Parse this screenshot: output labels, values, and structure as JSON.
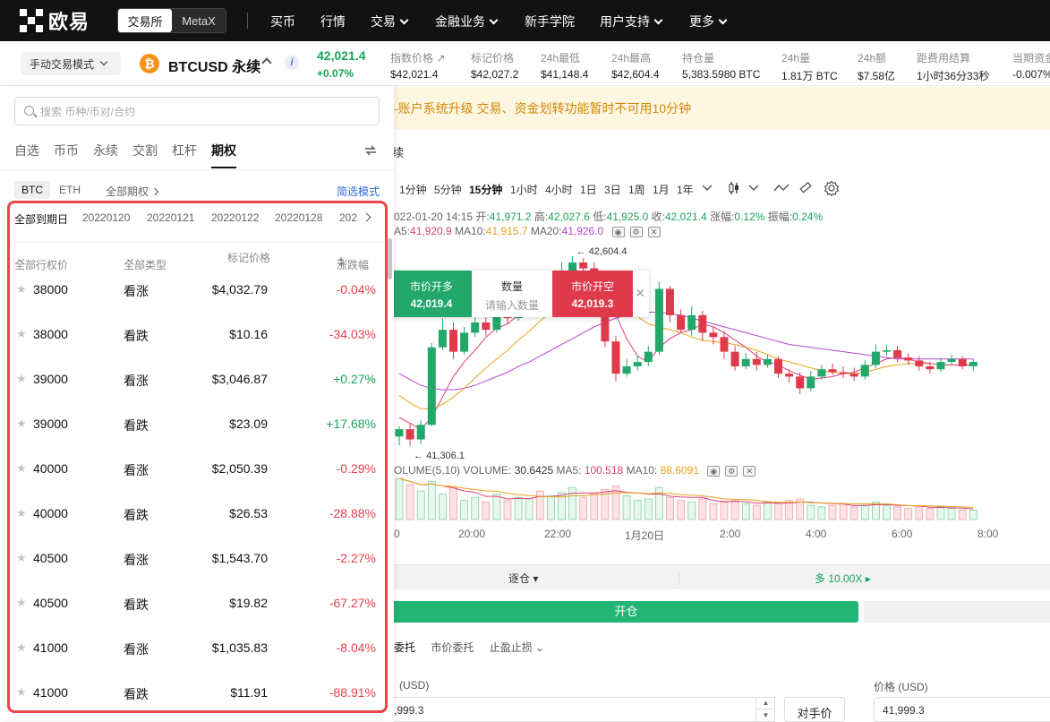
{
  "nav": {
    "logo_text": "欧易",
    "switch": [
      "交易所",
      "MetaX"
    ],
    "items": [
      {
        "label": "买币",
        "dropdown": false
      },
      {
        "label": "行情",
        "dropdown": false
      },
      {
        "label": "交易",
        "dropdown": true
      },
      {
        "label": "金融业务",
        "dropdown": true
      },
      {
        "label": "新手学院",
        "dropdown": false
      },
      {
        "label": "用户支持",
        "dropdown": true
      },
      {
        "label": "更多",
        "dropdown": true
      }
    ]
  },
  "ticker": {
    "mode": "手动交易模式",
    "symbol": "BTCUSD 永续",
    "coin_glyph": "₿",
    "info_glyph": "i",
    "last_price": "42,021.4",
    "change": "+0.07%",
    "stats": [
      {
        "label": "指数价格 ↗",
        "value": "$42,021.4"
      },
      {
        "label": "标记价格",
        "value": "$42,027.2"
      },
      {
        "label": "24h最低",
        "value": "$41,148.4"
      },
      {
        "label": "24h最高",
        "value": "$42,604.4"
      },
      {
        "label": "持仓量",
        "value": "5,383.5980 BTC"
      },
      {
        "label": "24h量",
        "value": "1.81万 BTC"
      },
      {
        "label": "24h额",
        "value": "$7.58亿"
      },
      {
        "label": "距费用结算",
        "value": "1小时36分33秒"
      },
      {
        "label": "当期资金",
        "value": "-0.007%"
      }
    ]
  },
  "notice": "-账户系统升级 交易、资金划转功能暂时不可用10分钟",
  "chart": {
    "title_fragment": "续",
    "timeframes": [
      "1分钟",
      "5分钟",
      "15分钟",
      "1小时",
      "4小时",
      "1日",
      "3日",
      "1周",
      "1月",
      "1年"
    ],
    "selected_timeframe": "15分钟",
    "ohlc": {
      "time": "022-01-20 14:15",
      "open_label": "开:",
      "open": "41,971.2",
      "high_label": "高:",
      "high": "42,027.6",
      "low_label": "低:",
      "low": "41,925.0",
      "close_label": "收:",
      "close": "42,021.4",
      "amp_label": "涨幅:",
      "amp": "0.12%",
      "swing_label": "振幅:",
      "swing": "0.24%"
    },
    "ma": [
      {
        "label": "A5:",
        "value": "41,920.9",
        "color": "#d9407a"
      },
      {
        "label": "MA10:",
        "value": "41,915.7",
        "color": "#e8a317"
      },
      {
        "label": "MA20:",
        "value": "41,926.0",
        "color": "#b546d6"
      }
    ],
    "high_marker": "42,604.4",
    "low_marker": "41,306.1",
    "volume_legend": {
      "name": "OLUME(5,10)",
      "vol_label": "VOLUME:",
      "vol": "30.6425",
      "ma5_label": "MA5:",
      "ma5": "100.518",
      "ma10_label": "MA10:",
      "ma10": "88.6091"
    },
    "xaxis": [
      "0",
      "20:00",
      "22:00",
      "1月20日",
      "2:00",
      "4:00",
      "6:00",
      "8:00"
    ],
    "quick_trade": {
      "buy_label": "市价开多",
      "buy_price": "42,019.4",
      "qty_label": "数量",
      "qty_placeholder": "请输入数量",
      "sell_label": "市价开空",
      "sell_price": "42,019.3",
      "close": "✕"
    }
  },
  "chart_data": {
    "type": "candlestick",
    "up_color": "#22a86a",
    "down_color": "#df3a4c",
    "candles": [
      {
        "o": 41370,
        "c": 41420,
        "h": 41440,
        "l": 41310
      },
      {
        "o": 41420,
        "c": 41350,
        "h": 41460,
        "l": 41306
      },
      {
        "o": 41350,
        "c": 41450,
        "h": 41480,
        "l": 41320
      },
      {
        "o": 41450,
        "c": 41980,
        "h": 42010,
        "l": 41440
      },
      {
        "o": 41980,
        "c": 42100,
        "h": 42180,
        "l": 41960
      },
      {
        "o": 42100,
        "c": 41950,
        "h": 42150,
        "l": 41900
      },
      {
        "o": 41950,
        "c": 42080,
        "h": 42120,
        "l": 41930
      },
      {
        "o": 42080,
        "c": 42150,
        "h": 42200,
        "l": 42050
      },
      {
        "o": 42150,
        "c": 42100,
        "h": 42210,
        "l": 42060
      },
      {
        "o": 42100,
        "c": 42230,
        "h": 42280,
        "l": 42080
      },
      {
        "o": 42230,
        "c": 42180,
        "h": 42300,
        "l": 42140
      },
      {
        "o": 42180,
        "c": 42300,
        "h": 42350,
        "l": 42160
      },
      {
        "o": 42300,
        "c": 42380,
        "h": 42430,
        "l": 42270
      },
      {
        "o": 42380,
        "c": 42320,
        "h": 42440,
        "l": 42290
      },
      {
        "o": 42320,
        "c": 42410,
        "h": 42460,
        "l": 42300
      },
      {
        "o": 42410,
        "c": 42500,
        "h": 42560,
        "l": 42390
      },
      {
        "o": 42500,
        "c": 42560,
        "h": 42604,
        "l": 42480
      },
      {
        "o": 42560,
        "c": 42520,
        "h": 42590,
        "l": 42470
      },
      {
        "o": 42520,
        "c": 42400,
        "h": 42560,
        "l": 42360
      },
      {
        "o": 42400,
        "c": 42020,
        "h": 42430,
        "l": 41980
      },
      {
        "o": 42020,
        "c": 41800,
        "h": 42060,
        "l": 41750
      },
      {
        "o": 41800,
        "c": 41850,
        "h": 41900,
        "l": 41780
      },
      {
        "o": 41850,
        "c": 41880,
        "h": 41920,
        "l": 41820
      },
      {
        "o": 41880,
        "c": 41950,
        "h": 41990,
        "l": 41850
      },
      {
        "o": 41950,
        "c": 42380,
        "h": 42430,
        "l": 41930
      },
      {
        "o": 42380,
        "c": 42200,
        "h": 42400,
        "l": 42150
      },
      {
        "o": 42200,
        "c": 42100,
        "h": 42240,
        "l": 42080
      },
      {
        "o": 42100,
        "c": 42200,
        "h": 42260,
        "l": 42060
      },
      {
        "o": 42200,
        "c": 42080,
        "h": 42230,
        "l": 42020
      },
      {
        "o": 42080,
        "c": 42050,
        "h": 42120,
        "l": 42000
      },
      {
        "o": 42050,
        "c": 41950,
        "h": 42090,
        "l": 41900
      },
      {
        "o": 41950,
        "c": 41850,
        "h": 41990,
        "l": 41820
      },
      {
        "o": 41850,
        "c": 41900,
        "h": 41940,
        "l": 41830
      },
      {
        "o": 41900,
        "c": 41860,
        "h": 41950,
        "l": 41820
      },
      {
        "o": 41860,
        "c": 41900,
        "h": 41930,
        "l": 41840
      },
      {
        "o": 41900,
        "c": 41800,
        "h": 41920,
        "l": 41770
      },
      {
        "o": 41800,
        "c": 41780,
        "h": 41830,
        "l": 41740
      },
      {
        "o": 41780,
        "c": 41700,
        "h": 41810,
        "l": 41660
      },
      {
        "o": 41700,
        "c": 41780,
        "h": 41820,
        "l": 41680
      },
      {
        "o": 41780,
        "c": 41830,
        "h": 41860,
        "l": 41760
      },
      {
        "o": 41830,
        "c": 41810,
        "h": 41870,
        "l": 41790
      },
      {
        "o": 41810,
        "c": 41800,
        "h": 41850,
        "l": 41770
      },
      {
        "o": 41800,
        "c": 41780,
        "h": 41840,
        "l": 41750
      },
      {
        "o": 41780,
        "c": 41860,
        "h": 41890,
        "l": 41760
      },
      {
        "o": 41860,
        "c": 41950,
        "h": 42000,
        "l": 41840
      },
      {
        "o": 41950,
        "c": 41960,
        "h": 42000,
        "l": 41920
      },
      {
        "o": 41960,
        "c": 41910,
        "h": 41990,
        "l": 41880
      },
      {
        "o": 41910,
        "c": 41890,
        "h": 41940,
        "l": 41860
      },
      {
        "o": 41890,
        "c": 41850,
        "h": 41920,
        "l": 41820
      },
      {
        "o": 41850,
        "c": 41830,
        "h": 41880,
        "l": 41800
      },
      {
        "o": 41830,
        "c": 41880,
        "h": 41910,
        "l": 41810
      },
      {
        "o": 41880,
        "c": 41900,
        "h": 41930,
        "l": 41860
      },
      {
        "o": 41900,
        "c": 41850,
        "h": 41920,
        "l": 41830
      },
      {
        "o": 41850,
        "c": 41880,
        "h": 41900,
        "l": 41820
      }
    ],
    "ma5": [
      41500,
      41460,
      41420,
      41500,
      41640,
      41780,
      41880,
      41960,
      42050,
      42110,
      42140,
      42200,
      42240,
      42290,
      42360,
      42410,
      42440,
      42460,
      42430,
      42340,
      42200,
      42040,
      41920,
      41880,
      41980,
      42040,
      42080,
      42100,
      42140,
      42120,
      42080,
      42030,
      41980,
      41920,
      41880,
      41860,
      41820,
      41790,
      41760,
      41770,
      41780,
      41800,
      41810,
      41840,
      41870,
      41900,
      41910,
      41900,
      41880,
      41870,
      41860,
      41860,
      41860,
      41860
    ],
    "ma10": [
      41650,
      41600,
      41560,
      41560,
      41590,
      41640,
      41700,
      41770,
      41840,
      41900,
      41960,
      42030,
      42090,
      42160,
      42220,
      42280,
      42320,
      42350,
      42360,
      42350,
      42300,
      42240,
      42190,
      42140,
      42120,
      42100,
      42080,
      42050,
      42030,
      42020,
      42010,
      42000,
      41980,
      41960,
      41930,
      41900,
      41880,
      41860,
      41840,
      41820,
      41810,
      41800,
      41800,
      41810,
      41830,
      41850,
      41860,
      41870,
      41870,
      41870,
      41860,
      41860,
      41860,
      41860
    ],
    "ma20": [
      41800,
      41760,
      41720,
      41700,
      41690,
      41690,
      41700,
      41720,
      41750,
      41780,
      41810,
      41850,
      41880,
      41920,
      41960,
      42000,
      42040,
      42080,
      42120,
      42150,
      42180,
      42200,
      42210,
      42220,
      42220,
      42210,
      42200,
      42180,
      42160,
      42140,
      42120,
      42100,
      42080,
      42060,
      42040,
      42020,
      42000,
      41990,
      41980,
      41970,
      41960,
      41950,
      41940,
      41930,
      41920,
      41910,
      41900,
      41900,
      41900,
      41900,
      41900,
      41900,
      41900,
      41900
    ],
    "volumes": [
      260,
      220,
      180,
      240,
      160,
      200,
      120,
      140,
      110,
      160,
      120,
      140,
      130,
      180,
      150,
      170,
      200,
      140,
      170,
      190,
      210,
      150,
      120,
      130,
      200,
      140,
      120,
      110,
      130,
      100,
      110,
      120,
      100,
      90,
      110,
      100,
      120,
      130,
      90,
      80,
      90,
      100,
      80,
      90,
      110,
      90,
      80,
      70,
      80,
      70,
      80,
      70,
      60,
      60
    ],
    "yrange": [
      41280,
      42640
    ]
  },
  "panel": {
    "search_placeholder": "搜索 币种/币对/合约",
    "tabs": [
      "自选",
      "币币",
      "永续",
      "交割",
      "杠杆",
      "期权"
    ],
    "selected_tab": "期权",
    "subtabs": [
      "BTC",
      "ETH",
      "全部期权"
    ],
    "filter_mode": "简选模式",
    "dates": [
      "全部到期日",
      "20220120",
      "20220121",
      "20220122",
      "20220128",
      "202"
    ],
    "headers": {
      "strike": "全部行权价",
      "type": "全部类型",
      "mark": "标记价格",
      "change": "涨跌幅"
    },
    "rows": [
      {
        "strike": "38000",
        "type": "看涨",
        "mark": "$4,032.79",
        "change": "-0.04%",
        "dir": "neg"
      },
      {
        "strike": "38000",
        "type": "看跌",
        "mark": "$10.16",
        "change": "-34.03%",
        "dir": "neg"
      },
      {
        "strike": "39000",
        "type": "看涨",
        "mark": "$3,046.87",
        "change": "+0.27%",
        "dir": "pos"
      },
      {
        "strike": "39000",
        "type": "看跌",
        "mark": "$23.09",
        "change": "+17.68%",
        "dir": "pos"
      },
      {
        "strike": "40000",
        "type": "看涨",
        "mark": "$2,050.39",
        "change": "-0.29%",
        "dir": "neg"
      },
      {
        "strike": "40000",
        "type": "看跌",
        "mark": "$26.53",
        "change": "-28.88%",
        "dir": "neg"
      },
      {
        "strike": "40500",
        "type": "看涨",
        "mark": "$1,543.70",
        "change": "-2.27%",
        "dir": "neg"
      },
      {
        "strike": "40500",
        "type": "看跌",
        "mark": "$19.82",
        "change": "-67.27%",
        "dir": "neg"
      },
      {
        "strike": "41000",
        "type": "看涨",
        "mark": "$1,035.83",
        "change": "-8.04%",
        "dir": "neg"
      },
      {
        "strike": "41000",
        "type": "看跌",
        "mark": "$11.91",
        "change": "-88.91%",
        "dir": "neg"
      }
    ]
  },
  "trade": {
    "margin_mode": "逐仓 ▾",
    "leverage": "多 10.00X ▸",
    "open_button": "开仓",
    "order_tabs": [
      "委托",
      "市价委托",
      "止盈止损 ⌄"
    ],
    "price_label_left": "(USD)",
    "price_value_left": ",999.3",
    "best_price_button": "对手价",
    "price_label_right": "价格 (USD)",
    "price_value_right": "41,999.3",
    "stepper_up": "▲",
    "stepper_down": "▼"
  }
}
